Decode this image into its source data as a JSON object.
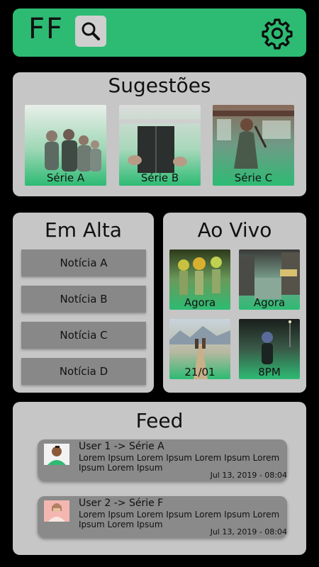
{
  "header": {
    "logo": "FF",
    "search_icon": "search-icon",
    "settings_icon": "gear-icon",
    "accent": "#2dbb73"
  },
  "suggestions": {
    "title": "Sugestões",
    "items": [
      {
        "label": "Série A",
        "image": "group-of-friends-photo"
      },
      {
        "label": "Série B",
        "image": "person-holding-book-photo"
      },
      {
        "label": "Série C",
        "image": "woman-on-trolley-photo"
      }
    ]
  },
  "trending": {
    "title": "Em Alta",
    "items": [
      "Notícia A",
      "Notícia B",
      "Notícia C",
      "Notícia D"
    ]
  },
  "live": {
    "title": "Ao Vivo",
    "items": [
      {
        "label": "Agora",
        "image": "festival-performers-photo"
      },
      {
        "label": "Agora",
        "image": "city-street-night-photo"
      },
      {
        "label": "21/01",
        "image": "hikers-mountain-road-photo"
      },
      {
        "label": "8PM",
        "image": "masked-figure-night-photo"
      }
    ]
  },
  "feed": {
    "title": "Feed",
    "posts": [
      {
        "title": "User 1 -> Série A",
        "text": "Lorem Ipsum Lorem Ipsum Lorem Ipsum Lorem Ipsum Lorem Ipsum",
        "time": "Jul 13, 2019 - 08:04",
        "avatar": "smiling-man-avatar"
      },
      {
        "title": "User 2 -> Série F",
        "text": "Lorem Ipsum Lorem Ipsum Lorem Ipsum Lorem Ipsum Lorem Ipsum",
        "time": "Jul 13, 2019 - 08:04",
        "avatar": "smiling-woman-avatar"
      }
    ]
  }
}
